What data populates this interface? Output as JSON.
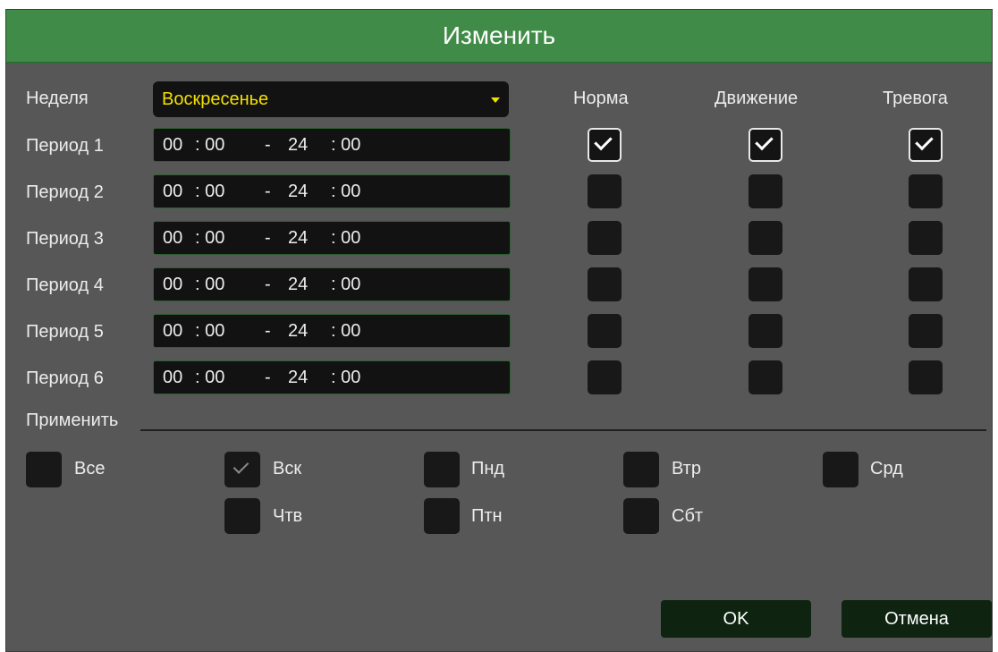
{
  "dialog": {
    "title": "Изменить"
  },
  "week": {
    "label": "Неделя",
    "selected": "Воскресенье"
  },
  "columns": {
    "normal": "Норма",
    "motion": "Движение",
    "alarm": "Тревога"
  },
  "periods": [
    {
      "label": "Период 1",
      "start_h": "00",
      "start_m": ": 00",
      "sep": "-",
      "end_h": "24",
      "end_m": ": 00",
      "normal": true,
      "motion": true,
      "alarm": true
    },
    {
      "label": "Период 2",
      "start_h": "00",
      "start_m": ": 00",
      "sep": "-",
      "end_h": "24",
      "end_m": ": 00",
      "normal": false,
      "motion": false,
      "alarm": false
    },
    {
      "label": "Период 3",
      "start_h": "00",
      "start_m": ": 00",
      "sep": "-",
      "end_h": "24",
      "end_m": ": 00",
      "normal": false,
      "motion": false,
      "alarm": false
    },
    {
      "label": "Период 4",
      "start_h": "00",
      "start_m": ": 00",
      "sep": "-",
      "end_h": "24",
      "end_m": ": 00",
      "normal": false,
      "motion": false,
      "alarm": false
    },
    {
      "label": "Период 5",
      "start_h": "00",
      "start_m": ": 00",
      "sep": "-",
      "end_h": "24",
      "end_m": ": 00",
      "normal": false,
      "motion": false,
      "alarm": false
    },
    {
      "label": "Период 6",
      "start_h": "00",
      "start_m": ": 00",
      "sep": "-",
      "end_h": "24",
      "end_m": ": 00",
      "normal": false,
      "motion": false,
      "alarm": false
    }
  ],
  "apply": {
    "label": "Применить",
    "days": [
      {
        "label": "Все",
        "checked": false
      },
      {
        "label": "Вск",
        "checked": true
      },
      {
        "label": "Пнд",
        "checked": false
      },
      {
        "label": "Втр",
        "checked": false
      },
      {
        "label": "Срд",
        "checked": false
      },
      {
        "label": "Чтв",
        "checked": false
      },
      {
        "label": "Птн",
        "checked": false
      },
      {
        "label": "Сбт",
        "checked": false
      }
    ]
  },
  "buttons": {
    "ok": "OK",
    "cancel": "Отмена"
  }
}
